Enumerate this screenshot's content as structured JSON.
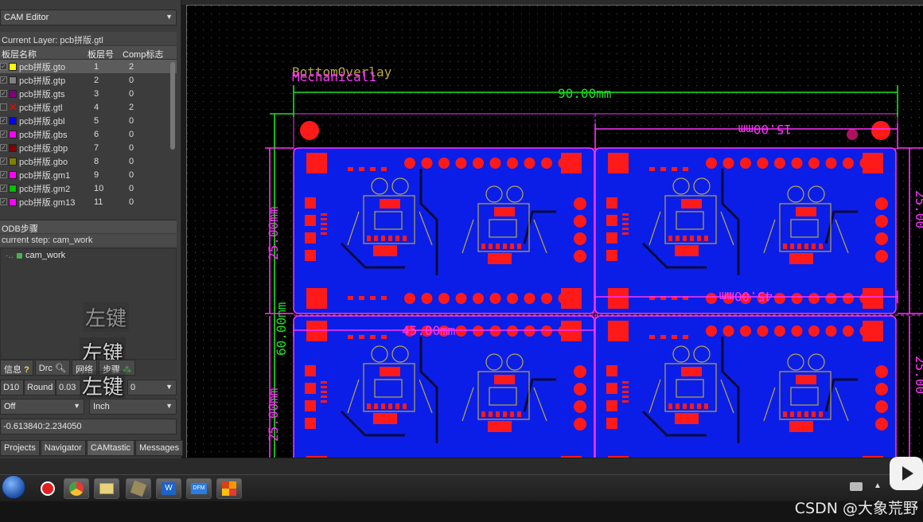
{
  "left_panel": {
    "editor_dropdown": "CAM Editor",
    "current_layer": "Current Layer: pcb拼版.gtl",
    "layer_columns": {
      "name": "板层名称",
      "number": "板层号",
      "comp": "Comp标志"
    },
    "layers": [
      {
        "name": "pcb拼版.gto",
        "number": "1",
        "comp": "2",
        "color": "#ffff00",
        "checked": true,
        "selected": true
      },
      {
        "name": "pcb拼版.gtp",
        "number": "2",
        "comp": "0",
        "color": "#808080",
        "checked": true,
        "selected": false
      },
      {
        "name": "pcb拼版.gts",
        "number": "3",
        "comp": "0",
        "color": "#800080",
        "checked": true,
        "selected": false
      },
      {
        "name": "pcb拼版.gtl",
        "number": "4",
        "comp": "2",
        "color": "#ff0000",
        "checked": false,
        "selected": false,
        "x_mark": true
      },
      {
        "name": "pcb拼版.gbl",
        "number": "5",
        "comp": "0",
        "color": "#0000ff",
        "checked": true,
        "selected": false
      },
      {
        "name": "pcb拼版.gbs",
        "number": "6",
        "comp": "0",
        "color": "#ff00ff",
        "checked": true,
        "selected": false
      },
      {
        "name": "pcb拼版.gbp",
        "number": "7",
        "comp": "0",
        "color": "#800000",
        "checked": true,
        "selected": false
      },
      {
        "name": "pcb拼版.gbo",
        "number": "8",
        "comp": "0",
        "color": "#808000",
        "checked": true,
        "selected": false
      },
      {
        "name": "pcb拼版.gm1",
        "number": "9",
        "comp": "0",
        "color": "#ff00ff",
        "checked": true,
        "selected": false
      },
      {
        "name": "pcb拼版.gm2",
        "number": "10",
        "comp": "0",
        "color": "#00c000",
        "checked": true,
        "selected": false
      },
      {
        "name": "pcb拼版.gm13",
        "number": "11",
        "comp": "0",
        "color": "#ff00ff",
        "checked": true,
        "selected": false
      }
    ],
    "odb_header": "ODB步骤",
    "current_step": "current step: cam_work",
    "odb_tree_item": "cam_work",
    "overlay_texts": [
      "左键",
      "左键",
      "左键"
    ],
    "tabs1": [
      {
        "label": "信息",
        "icon": "question-icon"
      },
      {
        "label": "Drc",
        "icon": "magnifier-icon"
      },
      {
        "label": "网络",
        "icon": ""
      },
      {
        "label": "步骤",
        "icon": "tree-icon"
      }
    ],
    "aperture": {
      "code": "D10",
      "shape": "Round",
      "size": "0.03",
      "extra": "0"
    },
    "mode_select": "Off",
    "unit_select": "Inch",
    "coordinate": "-0.613840:2.234050",
    "bottom_tabs": [
      "Projects",
      "Navigator",
      "CAMtastic",
      "Messages"
    ],
    "bottom_tab_active": "CAMtastic"
  },
  "canvas": {
    "label_bottom_overlay": "BottomOverlay",
    "label_mechanical": "Mechanical1",
    "dim_top": "90.00mm",
    "dim_top_right": "15.00mm",
    "dim_left_outer": "60.00mm",
    "dim_left_upper": "25.00mm",
    "dim_left_lower": "25.00mm",
    "dim_right_upper": "25.00",
    "dim_right_lower": "25.00",
    "dim_mid_right": "45.00mm",
    "dim_mid_left": "45.00mm",
    "colors": {
      "background": "#000000",
      "board": "#0b1ee8",
      "pad": "#ff1a1a",
      "dimension_green": "#1ee11e",
      "dimension_magenta": "#ff33ff",
      "silkscreen": "#b8a74a",
      "trace": "#0a0a3a"
    }
  },
  "taskbar": {
    "icons": [
      "windows-start-icon",
      "netease-music-icon",
      "chrome-icon",
      "explorer-icon",
      "app-icon",
      "wps-word-icon",
      "dfm-icon",
      "altium-icon"
    ],
    "tray_icons": [
      "keyboard-icon",
      "tray-arrow-icon"
    ],
    "watermark": "CSDN @大象荒野"
  }
}
